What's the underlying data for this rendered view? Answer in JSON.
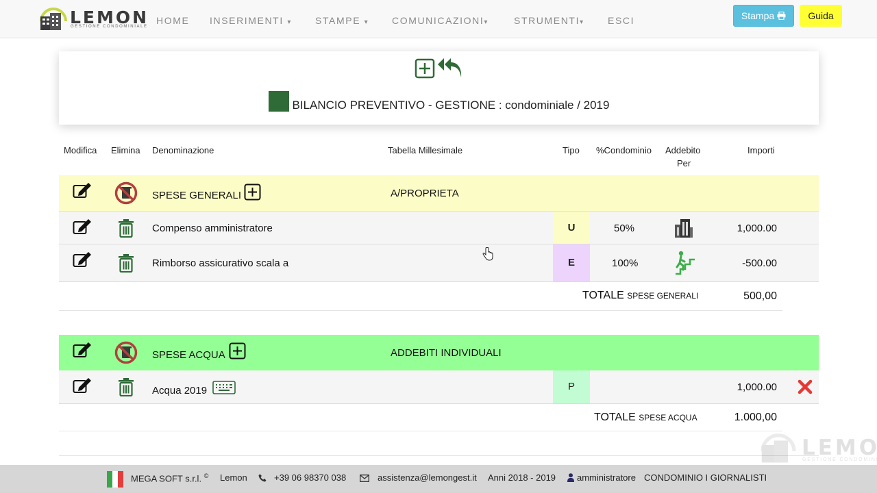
{
  "brand": {
    "name": "LEMON",
    "subtitle": "GESTIONE CONDOMINIALE"
  },
  "nav": {
    "home": "HOME",
    "inserimenti": "INSERIMENTI",
    "stampe": "STAMPE",
    "comunicazioni": "COMUNICAZIONI",
    "strumenti": "STRUMENTI",
    "esci": "ESCI"
  },
  "toolbar": {
    "stampa_label": "Stampa",
    "guida_label": "Guida"
  },
  "page": {
    "title": "BILANCIO PREVENTIVO - GESTIONE : condominiale / 2019"
  },
  "table": {
    "headers": {
      "modifica": "Modifica",
      "elimina": "Elimina",
      "denominazione": "Denominazione",
      "tabella": "Tabella Millesimale",
      "tipo": "Tipo",
      "condominio": "%Condominio",
      "addebito1": "Addebito",
      "addebito2": "Per",
      "importi": "Importi"
    }
  },
  "groups": [
    {
      "name": "SPESE GENERALI",
      "tabella": "A/PROPRIETA",
      "color": "#fcfcc6",
      "rows": [
        {
          "denominazione": "Compenso amministratore",
          "tipo": "U",
          "tipo_bg": "#fcfcc6",
          "percent": "50%",
          "addebito_icon": "building-icon",
          "importo": "1,000.00"
        },
        {
          "denominazione": "Rimborso assicurativo scala a",
          "tipo": "E",
          "tipo_bg": "#ecd4fc",
          "percent": "100%",
          "addebito_icon": "stairs-icon",
          "importo": "-500.00"
        }
      ],
      "totale_label": "TOTALE",
      "totale_small": "SPESE GENERALI",
      "totale_value": "500,00"
    },
    {
      "name": "SPESE ACQUA",
      "tabella": "ADDEBITI INDIVIDUALI",
      "color": "#94ff94",
      "rows": [
        {
          "denominazione": "Acqua 2019",
          "tipo": "P",
          "tipo_bg": "#c2fcd2",
          "percent": "",
          "importo": "1,000.00"
        }
      ],
      "totale_label": "TOTALE",
      "totale_small": "SPESE ACQUA",
      "totale_value": "1.000,00"
    }
  ],
  "footer": {
    "company": "MEGA SOFT s.r.l.",
    "copyright": "©",
    "product": "Lemon",
    "phone": "+39 06 98370 038",
    "email": "assistenza@lemongest.it",
    "anni": "Anni 2018 - 2019",
    "user": "amministratore",
    "condominio": "CONDOMINIO I GIORNALISTI"
  },
  "colors": {
    "accent_green": "#2e6b36",
    "info": "#5bc0de",
    "guida": "#ffff33",
    "danger": "#e53935"
  }
}
